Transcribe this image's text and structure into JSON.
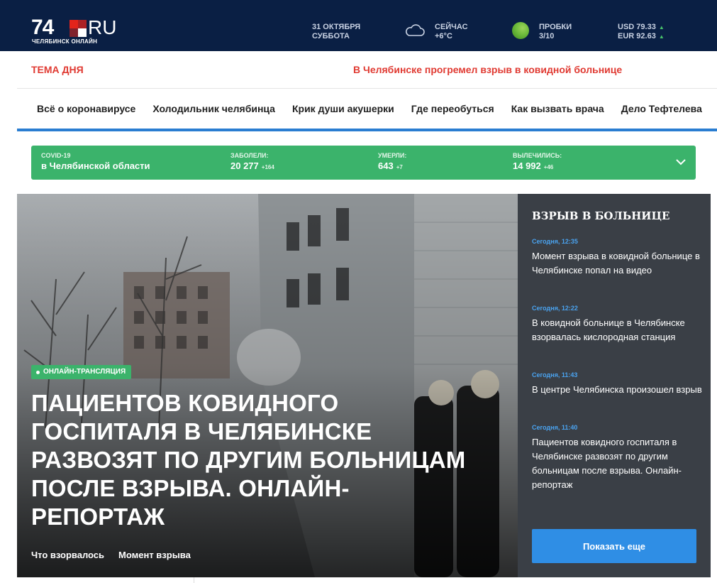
{
  "header": {
    "logo_number": "74",
    "logo_suffix": "RU",
    "logo_subtitle": "ЧЕЛЯБИНСК ОНЛАЙН",
    "date_line1": "31 ОКТЯБРЯ",
    "date_line2": "СУББОТА",
    "weather_line1": "СЕЙЧАС",
    "weather_line2": "+6°C",
    "traffic_line1": "ПРОБКИ",
    "traffic_line2": "3/10",
    "usd": "USD 79.33",
    "eur": "EUR 92.63",
    "bg_color": "#0a1f44"
  },
  "topic": {
    "label": "ТЕМА ДНЯ",
    "headline": "В Челябинске прогремел взрыв в ковидной больнице",
    "color": "#e03a32"
  },
  "nav": {
    "items": [
      "Всё о коронавирусе",
      "Холодильник челябинца",
      "Крик души акушерки",
      "Где переобуться",
      "Как вызвать врача",
      "Дело Тефтелева"
    ]
  },
  "covid": {
    "title": "COVID-19",
    "region": "в Челябинской области",
    "sick_label": "ЗАБОЛЕЛИ:",
    "sick_value": "20 277",
    "sick_inc": "+164",
    "dead_label": "УМЕРЛИ:",
    "dead_value": "643",
    "dead_inc": "+7",
    "recovered_label": "ВЫЛЕЧИЛИСЬ:",
    "recovered_value": "14 992",
    "recovered_inc": "+46",
    "bg_color": "#3bb36b"
  },
  "hero": {
    "badge": "ОНЛАЙН-ТРАНСЛЯЦИЯ",
    "title": "Пациентов ковидного госпиталя в Челябинске развозят по другим больницам после взрыва. Онлайн-репортаж",
    "links": [
      "Что взорвалось",
      "Момент взрыва"
    ]
  },
  "side": {
    "title": "ВЗРЫВ В БОЛЬНИЦЕ",
    "items": [
      {
        "time": "Сегодня, 12:35",
        "text": "Момент взрыва в ковидной больнице в Челябинске попал на видео"
      },
      {
        "time": "Сегодня, 12:22",
        "text": "В ковидной больнице в Челябинске взорвалась кислородная станция"
      },
      {
        "time": "Сегодня, 11:43",
        "text": "В центре Челябинска произошел взрыв"
      },
      {
        "time": "Сегодня, 11:40",
        "text": "Пациентов ковидного госпиталя в Челябинске развозят по другим больницам после взрыва. Онлайн-репортаж"
      }
    ],
    "more_button": "Показать еще",
    "button_color": "#2f8ee5"
  }
}
